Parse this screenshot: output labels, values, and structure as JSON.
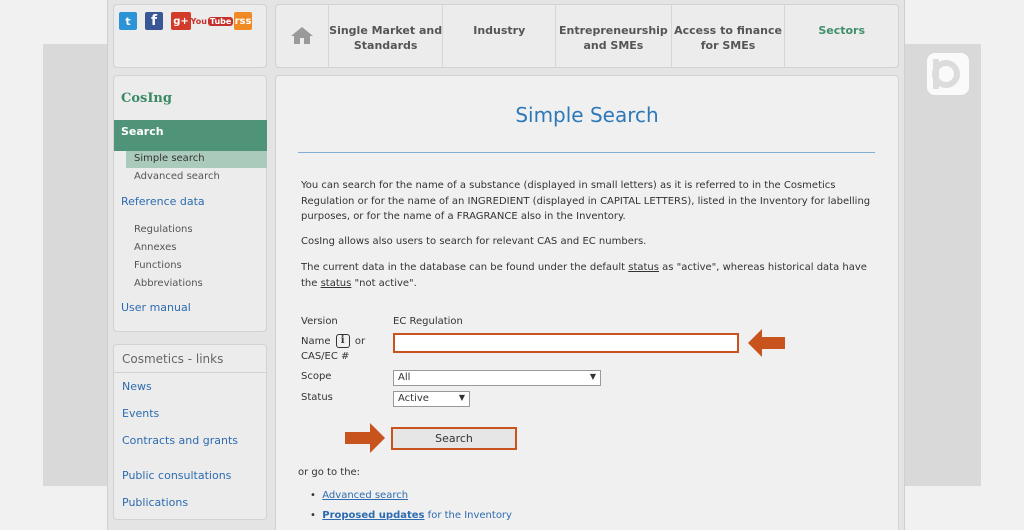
{
  "social": {
    "twitter": "t",
    "facebook": "f",
    "googleplus": "g+",
    "youtube_you": "You",
    "youtube_tube": "Tube",
    "rss": "rss"
  },
  "topnav": {
    "items": [
      "Single Market and Standards",
      "Industry",
      "Entrepreneurship and SMEs",
      "Access to finance for SMEs",
      "Sectors"
    ]
  },
  "sidebar": {
    "title": "CosIng",
    "search_label": "Search",
    "simple_search": "Simple search",
    "advanced_search": "Advanced search",
    "reference_data": "Reference data",
    "regulations": "Regulations",
    "annexes": "Annexes",
    "functions": "Functions",
    "abbreviations": "Abbreviations",
    "user_manual": "User manual"
  },
  "links": {
    "title": "Cosmetics - links",
    "items": [
      "News",
      "Events",
      "Contracts and grants",
      "Public consultations",
      "Publications"
    ]
  },
  "main": {
    "title": "Simple Search",
    "para1": "You can search for the name of a substance (displayed in small letters) as it is referred to in the Cosmetics Regulation or for the name of an INGREDIENT (displayed in CAPITAL LETTERS), listed in the Inventory for labelling purposes, or for the name of a FRAGRANCE also in the Inventory.",
    "para2": "CosIng allows also users to search for relevant CAS and EC numbers.",
    "para3_a": "The current data in the database can be found under the default ",
    "para3_status1": "status",
    "para3_b": " as \"active\", whereas historical data have the ",
    "para3_status2": "status",
    "para3_c": " \"not active\".",
    "version_label": "Version",
    "version_value": "EC Regulation",
    "name_label_a": "Name",
    "name_label_b": "or",
    "name_label_c": "CAS/EC #",
    "info_glyph": "i",
    "name_value": "",
    "scope_label": "Scope",
    "scope_value": "All",
    "status_label": "Status",
    "status_value": "Active",
    "search_button": "Search",
    "goto_text": "or go to the:",
    "goto_adv": "Advanced search",
    "goto_proposed": "Proposed updates",
    "goto_proposed_tail": " for the Inventory"
  },
  "colors": {
    "accent": "#4f9478",
    "highlight": "#c9531c",
    "link": "#2d6bb0"
  }
}
